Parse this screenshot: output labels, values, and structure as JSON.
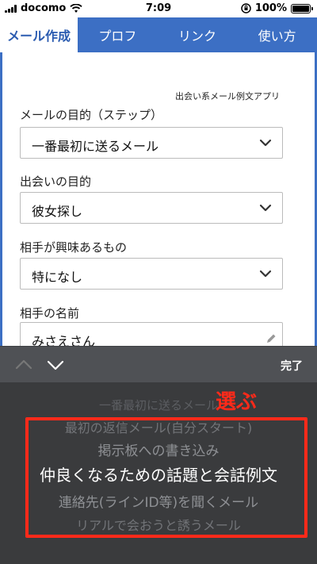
{
  "status_bar": {
    "carrier": "docomo",
    "time": "7:09",
    "battery_percent": "100%",
    "battery_level": 1.0
  },
  "tabs": [
    {
      "label": "メール作成",
      "active": true
    },
    {
      "label": "プロフ",
      "active": false
    },
    {
      "label": "リンク",
      "active": false
    },
    {
      "label": "使い方",
      "active": false
    }
  ],
  "app_subtitle": "出会い系メール例文アプリ",
  "form": {
    "purpose_step": {
      "label": "メールの目的（ステップ）",
      "value": "一番最初に送るメール"
    },
    "meeting_purpose": {
      "label": "出会いの目的",
      "value": "彼女探し"
    },
    "partner_interest": {
      "label": "相手が興味あるもの",
      "value": "特になし"
    },
    "partner_name": {
      "label": "相手の名前",
      "value": "みさえさん"
    }
  },
  "picker": {
    "done_label": "完了",
    "options": [
      "一番最初に送るメール",
      "最初の返信メール(自分スタート)",
      "掲示板への書き込み",
      "仲良くなるための話題と会話例文",
      "連絡先(ラインID等)を聞くメール",
      "リアルで会おうと誘うメール"
    ],
    "selected_index": 3
  },
  "annotation": "選ぶ",
  "colors": {
    "tab_blue": "#3c6fc4",
    "highlight_red": "#ff2a1a",
    "picker_bg": "#3a3b3d"
  }
}
